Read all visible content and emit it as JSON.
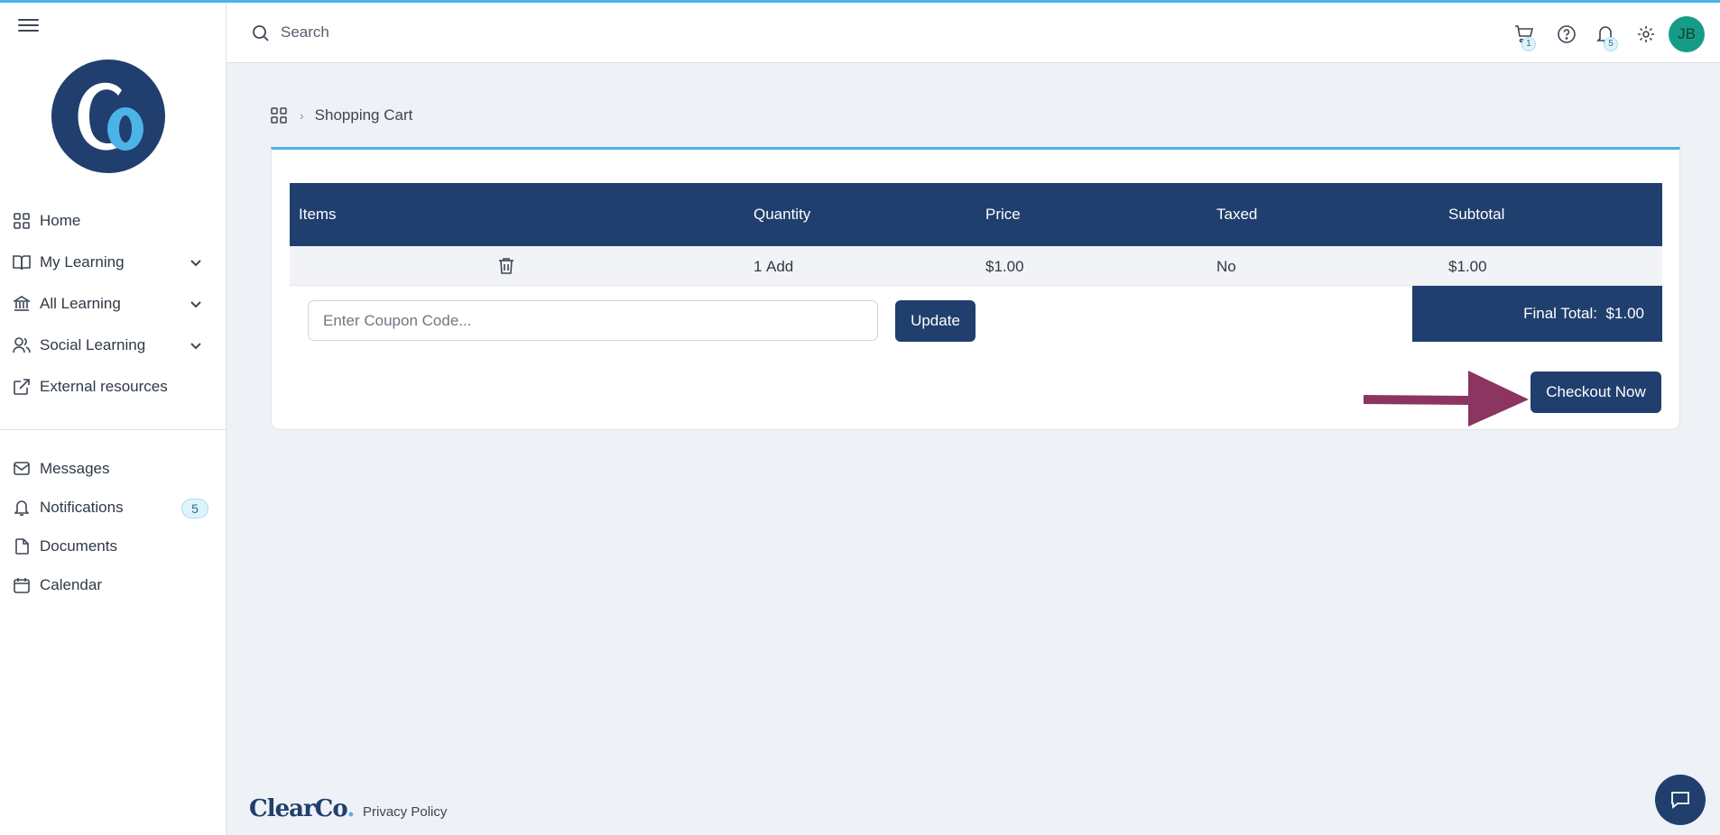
{
  "header": {
    "search_placeholder": "Search",
    "cart_count": "1",
    "notifications_count": "5",
    "avatar_initials": "JB"
  },
  "sidebar": {
    "items": [
      {
        "label": "Home",
        "icon": "grid-icon"
      },
      {
        "label": "My Learning",
        "icon": "book-icon",
        "expandable": true
      },
      {
        "label": "All Learning",
        "icon": "bank-icon",
        "expandable": true
      },
      {
        "label": "Social Learning",
        "icon": "users-icon",
        "expandable": true
      },
      {
        "label": "External resources",
        "icon": "external-link-icon"
      }
    ],
    "secondary": [
      {
        "label": "Messages",
        "icon": "mail-icon"
      },
      {
        "label": "Notifications",
        "icon": "bell-icon",
        "badge": "5"
      },
      {
        "label": "Documents",
        "icon": "document-icon"
      },
      {
        "label": "Calendar",
        "icon": "calendar-icon"
      }
    ]
  },
  "breadcrumb": {
    "current": "Shopping Cart"
  },
  "cart": {
    "columns": [
      "Items",
      "Quantity",
      "Price",
      "Taxed",
      "Subtotal"
    ],
    "row": {
      "quantity": "1",
      "add_label": "Add",
      "price": "$1.00",
      "taxed": "No",
      "subtotal": "$1.00"
    },
    "coupon_placeholder": "Enter Coupon Code...",
    "update_label": "Update",
    "final_total_label": "Final Total:",
    "final_total_value": "$1.00",
    "checkout_label": "Checkout Now"
  },
  "footer": {
    "logo_text": "ClearCo",
    "logo_dot": ".",
    "privacy_label": "Privacy Policy"
  },
  "colors": {
    "primary": "#203f6e",
    "accent": "#4cb3e6",
    "arrow": "#8b3560",
    "avatar": "#169c86"
  }
}
